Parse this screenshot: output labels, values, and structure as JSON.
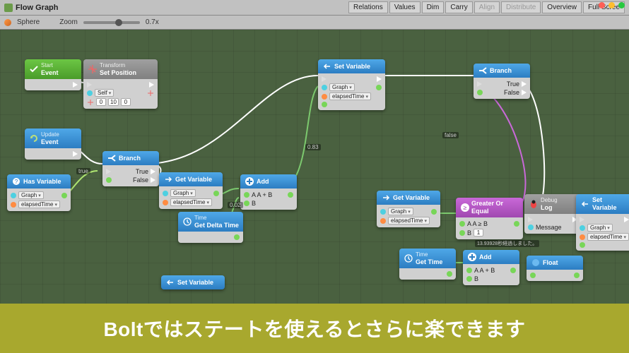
{
  "toolbar": {
    "title": "Flow Graph",
    "buttons": {
      "relations": "Relations",
      "values": "Values",
      "dim": "Dim",
      "carry": "Carry",
      "align": "Align",
      "distribute": "Distribute",
      "overview": "Overview",
      "fullscreen": "Full Scree"
    }
  },
  "subtoolbar": {
    "context": "Sphere",
    "zoom_label": "Zoom",
    "zoom_value": "0.7x"
  },
  "nodes": {
    "start": {
      "subtitle": "Start",
      "title": "Event"
    },
    "transform": {
      "subtitle": "Transform",
      "title": "Set Position",
      "self": "Self",
      "x": "0",
      "y": "10",
      "z": "0"
    },
    "update": {
      "subtitle": "Update",
      "title": "Event"
    },
    "hasvar": {
      "title": "Has Variable",
      "scope": "Graph",
      "var": "elapsedTime"
    },
    "branch1": {
      "title": "Branch",
      "true": "True",
      "false": "False"
    },
    "getvar1": {
      "title": "Get Variable",
      "scope": "Graph",
      "var": "elapsedTime"
    },
    "deltatime": {
      "subtitle": "Time",
      "title": "Get Delta Time"
    },
    "add1": {
      "title": "Add",
      "row1": "A  A + B",
      "row2": "B"
    },
    "setvar1": {
      "title": "Set Variable",
      "scope": "Graph",
      "var": "elapsedTime"
    },
    "getvar2": {
      "title": "Get Variable",
      "scope": "Graph",
      "var": "elapsedTime"
    },
    "greater": {
      "title": "Greater Or Equal",
      "row1": "A       A ≥ B",
      "row2": "B",
      "bval": "1"
    },
    "branch2": {
      "title": "Branch",
      "true": "True",
      "false": "False"
    },
    "debug": {
      "subtitle": "Debug",
      "title": "Log",
      "msg": "Message"
    },
    "setvar2": {
      "title": "Set Variable",
      "scope": "Graph",
      "var": "elapsedTime"
    },
    "gettime": {
      "subtitle": "Time",
      "title": "Get Time"
    },
    "add2": {
      "title": "Add",
      "row1": "A  A + B",
      "row2": "B"
    },
    "float": {
      "title": "Float"
    },
    "setvar3": {
      "title": "Set Variable"
    }
  },
  "wire_labels": {
    "true": "true",
    "false": "false",
    "val1": "0.83",
    "val2": "0.02",
    "val3": "13.93928秒経過しました。"
  },
  "banner": "Boltではステートを使えるとさらに楽できます"
}
